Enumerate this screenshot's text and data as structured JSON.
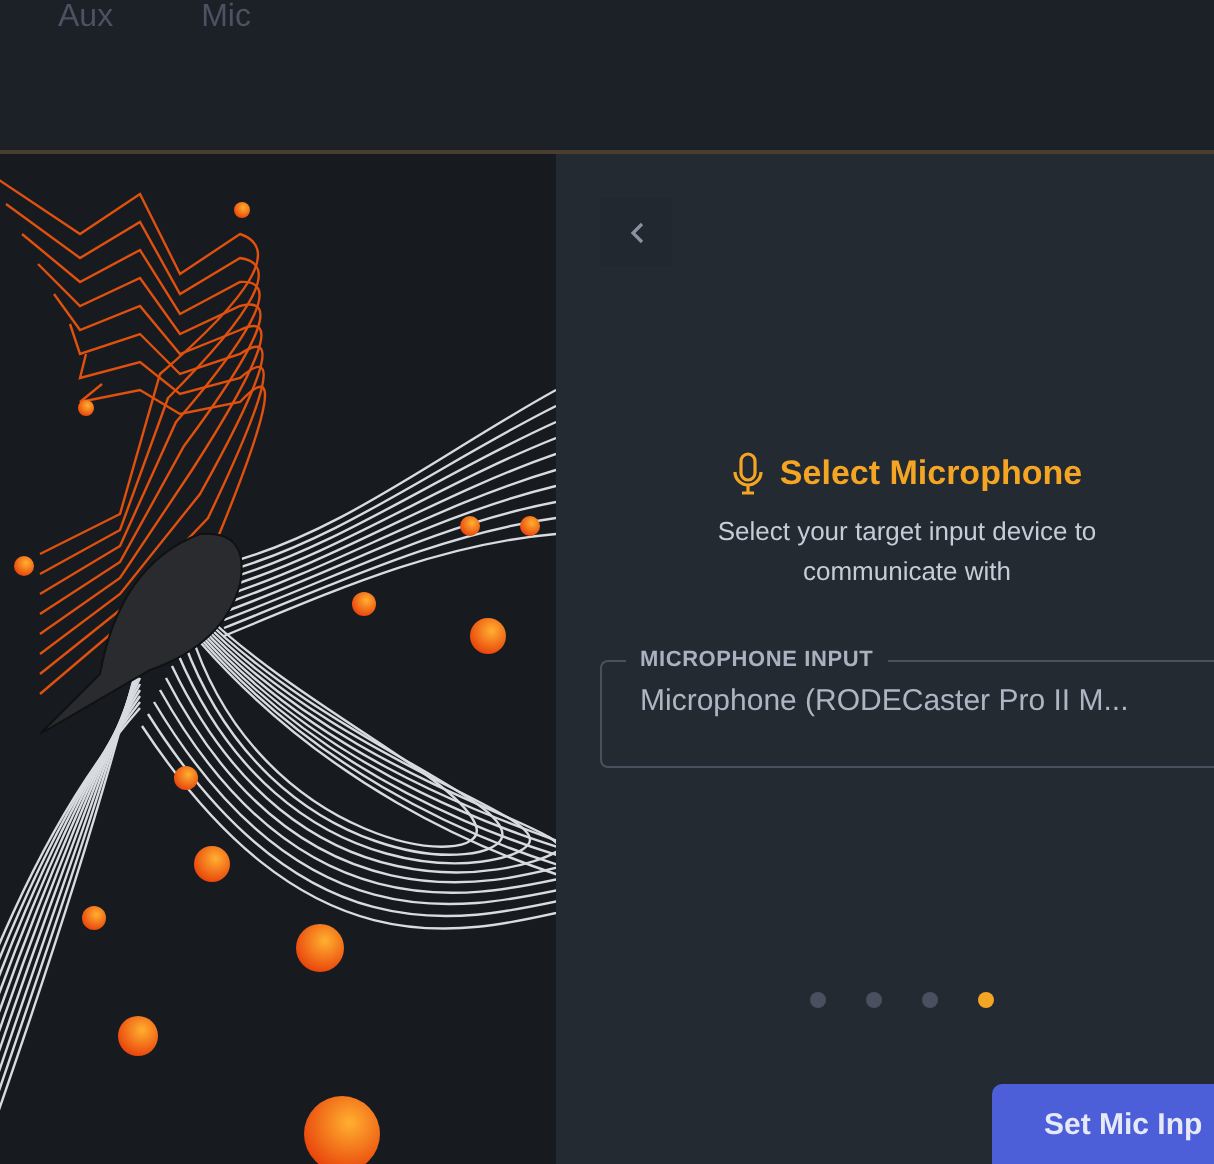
{
  "top_tabs": [
    {
      "label": "Aux"
    },
    {
      "label": "Mic"
    }
  ],
  "panel": {
    "title": "Select Microphone",
    "subtitle": "Select your target input device to communicate with",
    "field": {
      "label": "MICROPHONE INPUT",
      "value": "Microphone (RODECaster Pro II M..."
    },
    "steps": [
      {
        "selected": false
      },
      {
        "selected": false
      },
      {
        "selected": false
      },
      {
        "selected": true
      }
    ],
    "button": "Set Mic Inp"
  }
}
